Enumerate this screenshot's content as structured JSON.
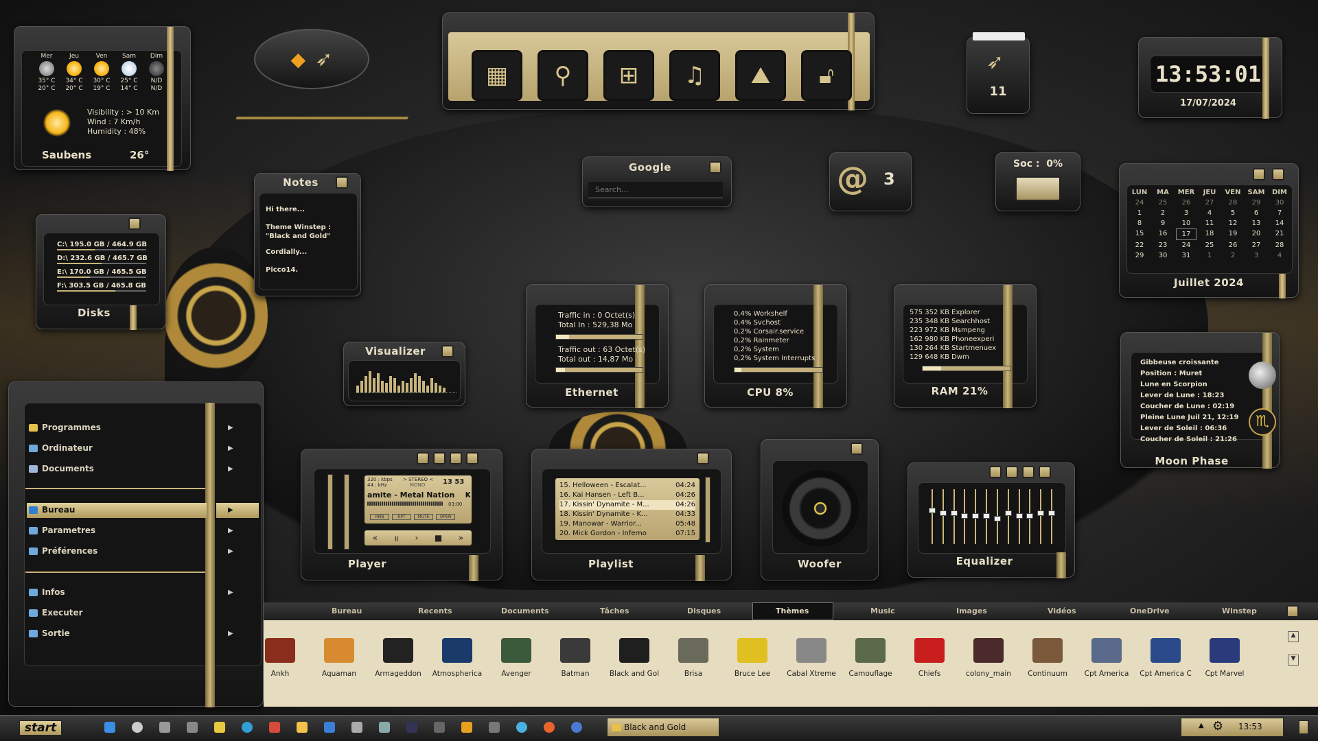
{
  "colors": {
    "gold": "#c9b57c",
    "dark": "#141414",
    "accent": "#d6c48c"
  },
  "weather": {
    "days": [
      {
        "name": "Mer",
        "max": "35° C",
        "min": "20° C",
        "icon": "cloud-icon"
      },
      {
        "name": "Jeu",
        "max": "34° C",
        "min": "20° C",
        "icon": "sun-icon"
      },
      {
        "name": "Ven",
        "max": "30° C",
        "min": "19° C",
        "icon": "sun-icon"
      },
      {
        "name": "Sam",
        "max": "25° C",
        "min": "14° C",
        "icon": "snow-cloud-icon"
      },
      {
        "name": "Dim",
        "max": "N/D",
        "min": "N/D",
        "icon": "na-icon"
      }
    ],
    "visibility": "Visibility : > 10 Km",
    "wind": "Wind : 7 Km/h",
    "humidity": "Humidity : 48%",
    "city": "Saubens",
    "temp": "26°"
  },
  "launcher": {
    "icons": [
      "windows-icon",
      "search-icon",
      "apps-grid-icon",
      "music-icon",
      "image-icon",
      "lock-icon"
    ]
  },
  "mail_count": "11",
  "clock": {
    "time": "13:53:01",
    "date": "17/07/2024"
  },
  "email": {
    "count": "3"
  },
  "battery": {
    "label": "Soc :  0%",
    "level": 0
  },
  "google": {
    "title": "Google",
    "placeholder": "Search..."
  },
  "notes": {
    "title": "Notes",
    "lines": [
      "Hi there...",
      "Theme Winstep :\n\"Black and Gold\"",
      "Cordially...",
      "Picco14."
    ]
  },
  "disks": {
    "title": "Disks",
    "items": [
      "C:\\  195.0 GB / 464.9 GB",
      "D:\\  232.6 GB / 465.7 GB",
      "E:\\  170.0 GB / 465.5 GB",
      "F:\\  303.5 GB / 465.8 GB"
    ],
    "usage": [
      0.42,
      0.5,
      0.37,
      0.65
    ]
  },
  "calendar": {
    "headers": [
      "LUN",
      "MA",
      "MER",
      "JEU",
      "VEN",
      "SAM",
      "DIM"
    ],
    "rows": [
      [
        "24",
        "25",
        "26",
        "27",
        "28",
        "29",
        "30"
      ],
      [
        "1",
        "2",
        "3",
        "4",
        "5",
        "6",
        "7"
      ],
      [
        "8",
        "9",
        "10",
        "11",
        "12",
        "13",
        "14"
      ],
      [
        "15",
        "16",
        "17",
        "18",
        "19",
        "20",
        "21"
      ],
      [
        "22",
        "23",
        "24",
        "25",
        "26",
        "27",
        "28"
      ],
      [
        "29",
        "30",
        "31",
        "1",
        "2",
        "3",
        "4"
      ]
    ],
    "title": "Juillet 2024",
    "today": "17"
  },
  "ethernet": {
    "title": "Ethernet",
    "traffic_in": "Traffic in : 0 Octet(s)",
    "total_in": "Total In : 529,38 Mo",
    "traffic_out": "Traffic out : 63 Octet(s)",
    "total_out": "Total out : 14,87 Mo",
    "in_level": 0.15,
    "out_level": 0.1
  },
  "cpu": {
    "title": "CPU  8%",
    "processes": [
      "0,4% Workshelf",
      "0,4% Svchost",
      "0,2% Corsair.service",
      "0,2% Rainmeter",
      "0,2% System",
      "0,2% System Interrupts"
    ],
    "level": 0.08
  },
  "ram": {
    "title": "RAM 21%",
    "processes": [
      "575 352 KB Explorer",
      "235 348 KB Searchhost",
      "223 972 KB Msmpeng",
      "162 980 KB Phoneexperi",
      "130 264 KB Startmenuex",
      "129 648 KB Dwm"
    ],
    "level": 0.21
  },
  "moon": {
    "title": "Moon Phase",
    "lines": [
      "Gibbeuse croissante",
      "Position : Muret",
      "Lune en Scorpion",
      "Lever de Lune : 18:23",
      "Coucher de Lune : 02:19",
      "Pleine Lune Juil 21, 12:19",
      "Lever de Soleil : 06:36",
      "Coucher de Soleil : 21:26"
    ]
  },
  "visualizer": {
    "title": "Visualizer",
    "bars": [
      0.3,
      0.5,
      0.7,
      0.9,
      0.6,
      0.8,
      0.5,
      0.4,
      0.7,
      0.6,
      0.3,
      0.5,
      0.4,
      0.6,
      0.8,
      0.7,
      0.5,
      0.3,
      0.6,
      0.4,
      0.3,
      0.2
    ]
  },
  "player": {
    "title": "Player",
    "kbps": "320 : kbps",
    "khz": "44 : kHz",
    "stereo": "> STEREO <",
    "mono": "MONO",
    "time": "13 53",
    "track": "amite - Metal Nation    Kis",
    "position": "03:00",
    "buttons_small": [
      "RNB",
      "RPT",
      "MUTE",
      "OPEN"
    ],
    "controls": [
      "prev-icon",
      "pause-icon",
      "play-icon",
      "stop-icon",
      "next-icon"
    ]
  },
  "playlist": {
    "title": "Playlist",
    "items": [
      {
        "t": "15. Helloween - Escalat...",
        "d": "04:24"
      },
      {
        "t": "16. Kai Hansen - Left B...",
        "d": "04:26"
      },
      {
        "t": "17. Kissin' Dynamite - M...",
        "d": "04:26"
      },
      {
        "t": "18. Kissin' Dynamite - K...",
        "d": "04:33"
      },
      {
        "t": "19. Manowar - Warrior...",
        "d": "05:48"
      },
      {
        "t": "20. Mick Gordon - Inferno",
        "d": "07:15"
      }
    ],
    "active": 2
  },
  "woofer": {
    "title": "Woofer"
  },
  "equalizer": {
    "title": "Equalizer",
    "bands": [
      0.6,
      0.55,
      0.55,
      0.5,
      0.5,
      0.5,
      0.45,
      0.55,
      0.5,
      0.5,
      0.55,
      0.55
    ]
  },
  "menu": {
    "items": [
      "Programmes",
      "Ordinateur",
      "Documents",
      "Bureau",
      "Parametres",
      "Préférences",
      "Infos",
      "Executer",
      "Sortie"
    ],
    "selected": "Bureau"
  },
  "tabs": {
    "items": [
      "Bureau",
      "Recents",
      "Documents",
      "Tâches",
      "Disques",
      "Thèmes",
      "Music",
      "Images",
      "Vidéos",
      "OneDrive",
      "Winstep"
    ],
    "active": "Thèmes"
  },
  "themes": [
    {
      "name": "Ankh",
      "color": "#8a2d1c"
    },
    {
      "name": "Aquaman",
      "color": "#d88a30"
    },
    {
      "name": "Armageddon",
      "color": "#222"
    },
    {
      "name": "Atmospherica",
      "color": "#1a3a6a"
    },
    {
      "name": "Avenger",
      "color": "#3b5a3b"
    },
    {
      "name": "Batman",
      "color": "#3a3a3a"
    },
    {
      "name": "Black and Gol",
      "color": "#1f1f1f"
    },
    {
      "name": "Brisa",
      "color": "#6a6a5a"
    },
    {
      "name": "Bruce Lee",
      "color": "#e0c020"
    },
    {
      "name": "Cabal Xtreme",
      "color": "#888"
    },
    {
      "name": "Camouflage",
      "color": "#5a6a4a"
    },
    {
      "name": "Chiefs",
      "color": "#c81e1e"
    },
    {
      "name": "colony_main",
      "color": "#4a2a2a"
    },
    {
      "name": "Continuum",
      "color": "#7a5a3a"
    },
    {
      "name": "Cpt America",
      "color": "#5a6a8a"
    },
    {
      "name": "Cpt America C",
      "color": "#2a4a8a"
    },
    {
      "name": "Cpt Marvel",
      "color": "#2a3a7a"
    }
  ],
  "taskbar": {
    "start": "start",
    "window": "Black and Gold",
    "time": "13:53"
  }
}
